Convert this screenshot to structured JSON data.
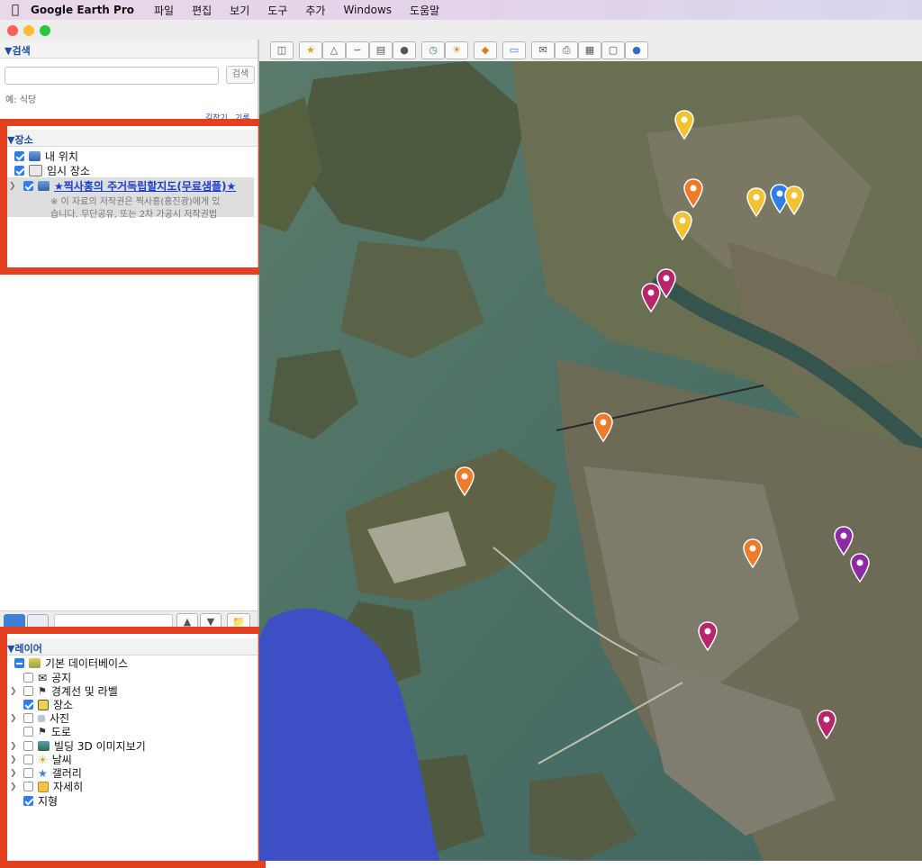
{
  "menubar": {
    "app_name": "Google Earth Pro",
    "items": [
      "파일",
      "편집",
      "보기",
      "도구",
      "추가",
      "Windows",
      "도움말"
    ]
  },
  "search": {
    "header": "▼검색",
    "placeholder": "",
    "button": "검색",
    "hint": "예: 식당",
    "links": [
      "길찾기",
      "기록"
    ]
  },
  "places": {
    "header": "▼장소",
    "items": [
      {
        "label": "내 위치",
        "checked": true
      },
      {
        "label": "임시 장소",
        "checked": true
      },
      {
        "label": "★찍사홍의 주거독립할지도(무료샘플)★",
        "checked": true,
        "desc_line1": "※ 이 자료의 저작권은 찍사홍(홍진광)에게 있",
        "desc_line2": "습니다. 무단공유, 또는 2차 가공시 저작권법"
      }
    ]
  },
  "layers": {
    "header": "▼레이어",
    "root": "기본 데이터베이스",
    "items": [
      {
        "label": "공지",
        "checked": false,
        "icon": "envelope-icon"
      },
      {
        "label": "경계선 및 라벨",
        "checked": false,
        "icon": "flag-icon"
      },
      {
        "label": "장소",
        "checked": true,
        "icon": "place-icon"
      },
      {
        "label": "사진",
        "checked": false,
        "icon": "photo-icon"
      },
      {
        "label": "도로",
        "checked": false,
        "icon": "road-icon"
      },
      {
        "label": "빌딩 3D 이미지보기",
        "checked": false,
        "icon": "building-icon"
      },
      {
        "label": "날씨",
        "checked": false,
        "icon": "sun-icon"
      },
      {
        "label": "갤러리",
        "checked": false,
        "icon": "star-icon"
      },
      {
        "label": "자세히",
        "checked": false,
        "icon": "more-icon"
      },
      {
        "label": "지형",
        "checked": true,
        "icon": ""
      }
    ]
  },
  "colors": {
    "highlight": "#e2401f",
    "link": "#1d4ea6",
    "pin_yellow": "#f2c230",
    "pin_orange": "#ef7a2a",
    "pin_blue": "#2f7ee8",
    "pin_magenta": "#b8256b",
    "pin_purple": "#8d2aa6"
  }
}
